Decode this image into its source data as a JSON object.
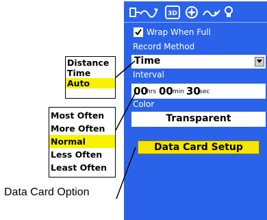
{
  "toolbar": {
    "icons": [
      "track-tab-icon",
      "3d-tab-icon",
      "compass-tab-icon",
      "route-tab-icon",
      "light-tab-icon"
    ],
    "3d_label": "3D"
  },
  "settings": {
    "wrap_label": "Wrap When Full",
    "wrap_checked": true,
    "record_method_label": "Record Method",
    "record_method_value": "Time",
    "interval_label": "Interval",
    "interval": {
      "hours": "00",
      "hours_unit": "hrs",
      "minutes": "00",
      "minutes_unit": "min",
      "seconds": "30",
      "seconds_unit": "sec"
    },
    "color_label": "Color",
    "color_value": "Transparent",
    "data_card_button": "Data Card Setup"
  },
  "record_method_options": [
    "Distance",
    "Time",
    "Auto"
  ],
  "record_method_highlight": "Auto",
  "interval_options": [
    "Most Often",
    "More Often",
    "Normal",
    "Less Often",
    "Least Often"
  ],
  "interval_highlight": "Normal",
  "callout_label": "Data Card Option",
  "colors": {
    "screen": "#2a63ea",
    "highlight": "#f7f200",
    "button": "#f7e600"
  }
}
